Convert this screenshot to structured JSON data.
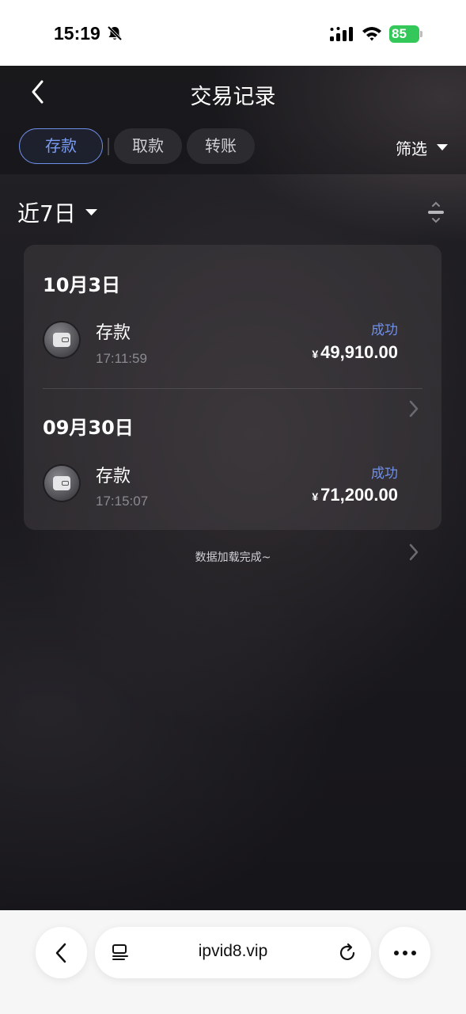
{
  "status_bar": {
    "time": "15:19",
    "battery_level": "85",
    "icons": [
      "bell-slash-icon",
      "signal-icon",
      "wifi-icon",
      "battery-charging-icon"
    ]
  },
  "header": {
    "title": "交易记录",
    "tabs": [
      {
        "label": "存款",
        "active": true
      },
      {
        "label": "取款",
        "active": false
      },
      {
        "label": "转账",
        "active": false
      }
    ],
    "filter_label": "筛选"
  },
  "period": {
    "label": "近7日"
  },
  "transactions": [
    {
      "date": "10月3日",
      "type": "存款",
      "time": "17:11:59",
      "status": "成功",
      "currency": "¥",
      "amount": "49,910.00"
    },
    {
      "date": "09月30日",
      "type": "存款",
      "time": "17:15:07",
      "status": "成功",
      "currency": "¥",
      "amount": "71,200.00"
    }
  ],
  "footer_text": "数据加载完成~",
  "browser": {
    "url": "ipvid8.vip"
  },
  "colors": {
    "accent": "#6f8fe8",
    "battery": "#34c759",
    "background": "#1c1b1f"
  }
}
